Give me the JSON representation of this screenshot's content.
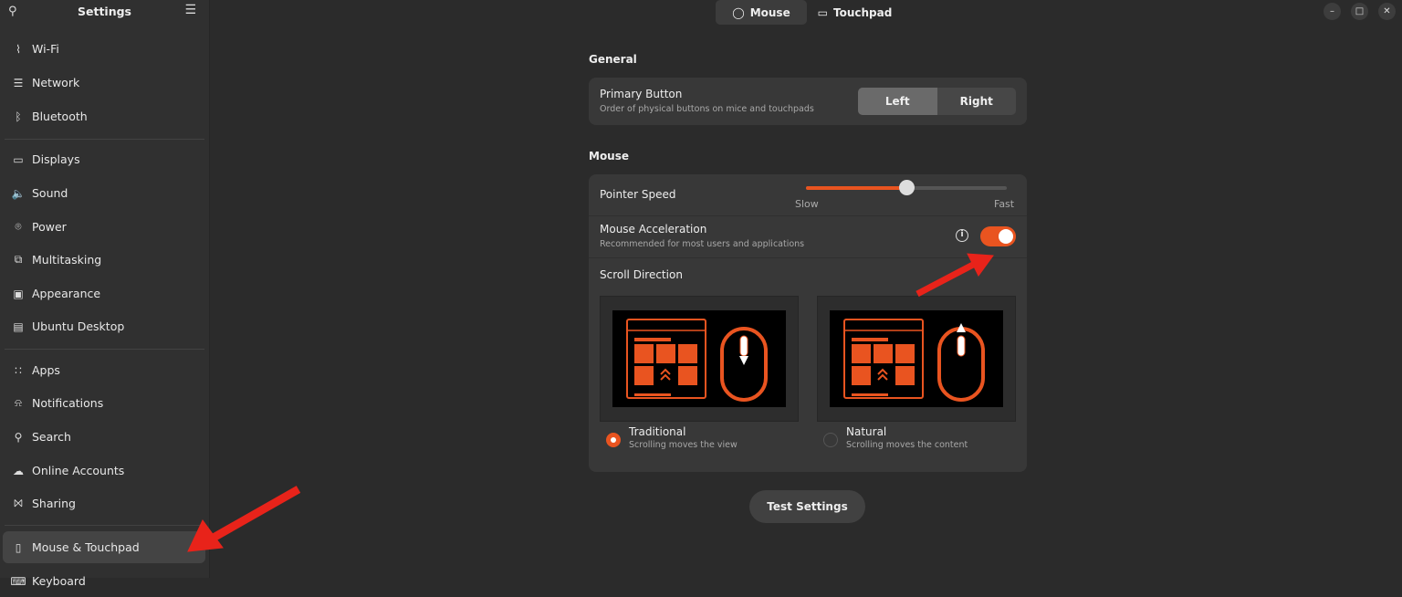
{
  "sidebar": {
    "title": "Settings",
    "items": [
      {
        "label": "Wi-Fi",
        "icon": "wifi-icon"
      },
      {
        "label": "Network",
        "icon": "network-icon"
      },
      {
        "label": "Bluetooth",
        "icon": "bluetooth-icon"
      },
      {
        "label": "Displays",
        "icon": "display-icon"
      },
      {
        "label": "Sound",
        "icon": "sound-icon"
      },
      {
        "label": "Power",
        "icon": "power-icon"
      },
      {
        "label": "Multitasking",
        "icon": "multitasking-icon"
      },
      {
        "label": "Appearance",
        "icon": "appearance-icon"
      },
      {
        "label": "Ubuntu Desktop",
        "icon": "ubuntu-desktop-icon"
      },
      {
        "label": "Apps",
        "icon": "apps-icon"
      },
      {
        "label": "Notifications",
        "icon": "bell-icon"
      },
      {
        "label": "Search",
        "icon": "search-icon"
      },
      {
        "label": "Online Accounts",
        "icon": "cloud-icon"
      },
      {
        "label": "Sharing",
        "icon": "share-icon"
      },
      {
        "label": "Mouse & Touchpad",
        "icon": "mouse-icon"
      },
      {
        "label": "Keyboard",
        "icon": "keyboard-icon"
      }
    ],
    "selected": "Mouse & Touchpad"
  },
  "tabs": {
    "mouse": "Mouse",
    "touchpad": "Touchpad"
  },
  "general": {
    "heading": "General",
    "primary_button": {
      "label": "Primary Button",
      "sub": "Order of physical buttons on mice and touchpads",
      "left": "Left",
      "right": "Right",
      "selected": "Left"
    }
  },
  "mouse": {
    "heading": "Mouse",
    "pointer_speed": {
      "label": "Pointer Speed",
      "min_label": "Slow",
      "max_label": "Fast",
      "value": 0.5
    },
    "acceleration": {
      "label": "Mouse Acceleration",
      "sub": "Recommended for most users and applications",
      "enabled": true
    },
    "scroll": {
      "label": "Scroll Direction",
      "traditional": {
        "label": "Traditional",
        "sub": "Scrolling moves the view",
        "selected": true
      },
      "natural": {
        "label": "Natural",
        "sub": "Scrolling moves the content",
        "selected": false
      }
    }
  },
  "test_button": "Test Settings",
  "colors": {
    "accent": "#e95420",
    "annotation": "#e8231a"
  }
}
